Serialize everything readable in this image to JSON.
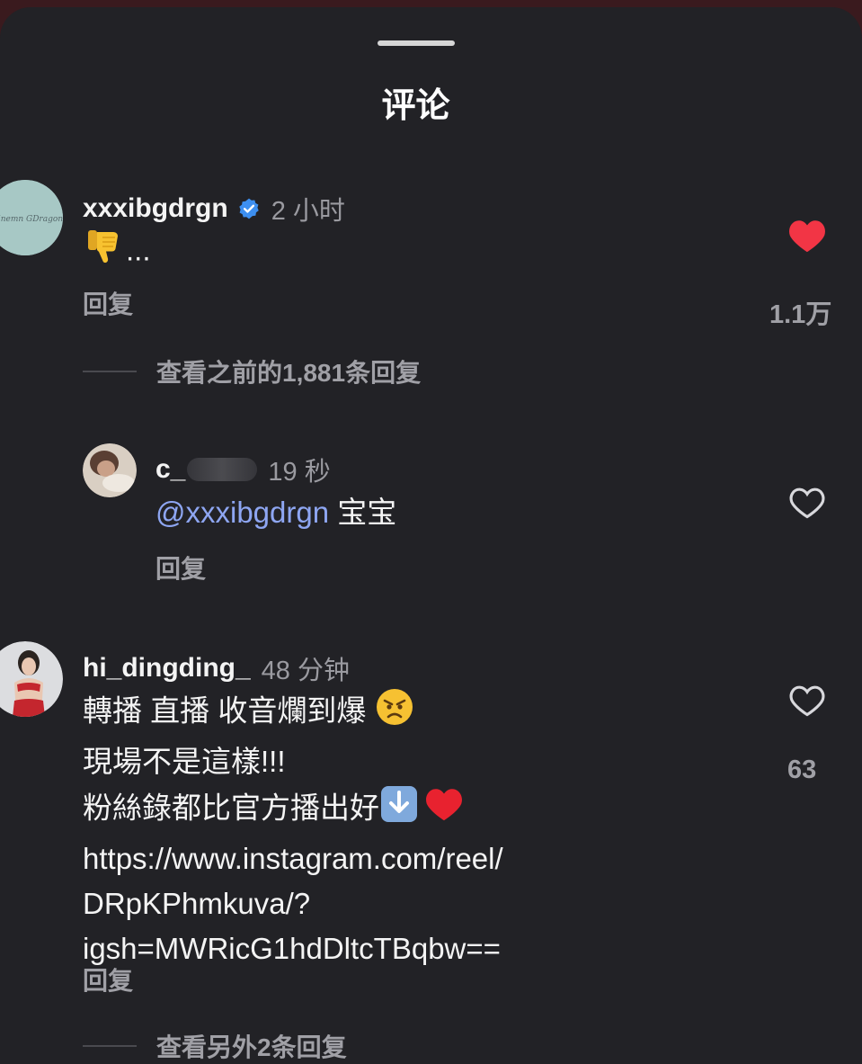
{
  "sheet": {
    "title": "评论"
  },
  "comments": [
    {
      "username": "xxxibgdrgn",
      "verified": true,
      "time": "2 小时",
      "text": "👎...",
      "text_emoji": "thumbs-down",
      "text_suffix": "...",
      "reply_label": "回复",
      "liked": true,
      "like_count": "1.1万",
      "view_replies": "查看之前的1,881条回复",
      "avatar_script": "Ninemn GDragon"
    },
    {
      "username": "c_",
      "username_obscured": true,
      "time": "19 秒",
      "mention": "@xxxibgdrgn",
      "text": "宝宝",
      "reply_label": "回复",
      "liked": false
    },
    {
      "username": "hi_dingding_",
      "time": "48 分钟",
      "lines": [
        "轉播 直播 收音爛到爆",
        "現場不是這樣!!!",
        "粉絲錄都比官方播出好",
        "https://www.instagram.com/reel/",
        "DRpKPhmkuva/?",
        "igsh=MWRicG1hdDltcTBqbw=="
      ],
      "line1_emoji": "angry-face",
      "line3_emojis": [
        "down-arrow-button",
        "red-heart"
      ],
      "reply_label": "回复",
      "liked": false,
      "like_count": "63",
      "view_replies": "查看另外2条回复"
    }
  ],
  "colors": {
    "sheet_bg": "#222226",
    "mention": "#8ea6f2",
    "like_active": "#f23545",
    "verified": "#3d8ff0"
  }
}
